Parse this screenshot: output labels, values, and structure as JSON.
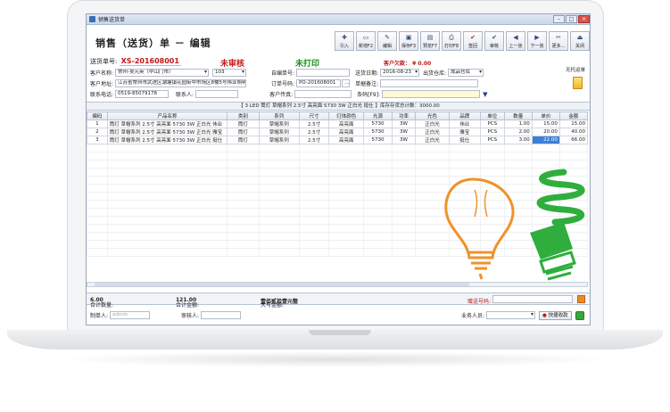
{
  "window": {
    "title": "销售送货单"
  },
  "header": {
    "doc_title": "销售（送货）单 － 编辑"
  },
  "toolbar": [
    {
      "label": "引入",
      "icon": "✚"
    },
    {
      "label": "新增F2",
      "icon": "▭"
    },
    {
      "label": "编辑",
      "icon": "✎"
    },
    {
      "label": "保存F3",
      "icon": "▣"
    },
    {
      "label": "预览F7",
      "icon": "▤"
    },
    {
      "label": "打印F8",
      "icon": "⎙"
    },
    {
      "label": "签回",
      "icon": "✔"
    },
    {
      "label": "审核",
      "icon": "✔"
    },
    {
      "label": "上一张",
      "icon": "◀"
    },
    {
      "label": "下一张",
      "icon": "▶"
    },
    {
      "label": "更多...",
      "icon": "✂"
    },
    {
      "label": "关闭",
      "icon": "⏏"
    }
  ],
  "status": {
    "doc_no_label": "送货单号:",
    "doc_no": "XS-201608001",
    "audit": "未审核",
    "print": "未打印",
    "owed_label": "客户欠款：",
    "owed": "¥ 0.00"
  },
  "form": {
    "customer_label": "客户名称:",
    "customer": "常州-吴元英（中山门市）",
    "customer_code": "103",
    "custom_no_label": "自编单号:",
    "custom_no": "",
    "date_label": "送货日期:",
    "date": "2016-08-23",
    "warehouse_label": "出货仓库:",
    "warehouse": "成品仓库",
    "address_label": "客户地址:",
    "address": "江苏省常州市武进区湖塘镇花园街中市场区8楼5号伟业照明",
    "order_label": "订单号码:",
    "order": "PO-201608001",
    "note_label": "单据备注:",
    "note": "",
    "phone_label": "联系电话:",
    "phone": "0519-85079178",
    "contact_label": "联系人:",
    "contact": "",
    "fax_label": "客户传真:",
    "fax": "",
    "barcode_label": "条码[F9]:",
    "barcode": "",
    "side_label": "无托运单"
  },
  "info_bar": "【 3 LED 筒灯 草帽系列 2.5寸 高亮面 5730 3W 正白光 挺仕 】库存存货总计数：3000.00",
  "table": {
    "headers": [
      "编码",
      "产品名称",
      "类别",
      "系列",
      "尺寸",
      "灯体颜色",
      "光源",
      "功率",
      "光色",
      "品牌",
      "单位",
      "数量",
      "单价",
      "金额"
    ],
    "rows": [
      [
        "1",
        "筒灯 草帽系列 2.5寸 高亮面 5730 3W 正白光 伟业",
        "筒灯",
        "草帽系列",
        "2.5寸",
        "高亮面",
        "5730",
        "3W",
        "正白光",
        "伟业",
        "PCS",
        "1.00",
        "15.00",
        "15.00"
      ],
      [
        "2",
        "筒灯 草帽系列 2.5寸 高亮面 5730 3W 正白光 雅宝",
        "筒灯",
        "草帽系列",
        "2.5寸",
        "高亮面",
        "5730",
        "3W",
        "正白光",
        "雅宝",
        "PCS",
        "2.00",
        "20.00",
        "40.00"
      ],
      [
        "3",
        "筒灯 草帽系列 2.5寸 高亮面 5730 3W 正白光 挺仕",
        "筒灯",
        "草帽系列",
        "2.5寸",
        "高亮面",
        "5730",
        "3W",
        "正白光",
        "挺仕",
        "PCS",
        "3.00",
        "22.00",
        "66.00"
      ]
    ]
  },
  "totals": {
    "qty_label": "合计数量:",
    "qty": "6.00",
    "amount_label": "合计金额:",
    "amount": "121.00",
    "upper_label": "大写金额:",
    "upper": "壹佰贰拾壹元整",
    "coupon_label": "赠送号码:"
  },
  "footer": {
    "maker_label": "制单人:",
    "maker": "admin",
    "auditor_label": "审核人:",
    "auditor": "",
    "sales_label": "业务人员:",
    "sales": "",
    "quick_label": "快捷收款"
  }
}
